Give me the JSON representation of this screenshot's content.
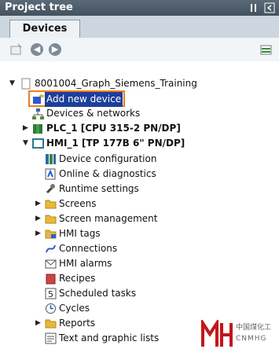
{
  "title": "Project tree",
  "tab_label": "Devices",
  "project": "8001004_Graph_Siemens_Training",
  "tree": [
    {
      "label": "Add new device",
      "icon": "add-device-icon"
    },
    {
      "label": "Devices & networks",
      "icon": "network-icon"
    },
    {
      "label": "PLC_1 [CPU 315-2 PN/DP]",
      "icon": "plc-icon"
    },
    {
      "label": "HMI_1 [TP 177B 6\" PN/DP]",
      "icon": "hmi-icon"
    },
    {
      "label": "Device configuration",
      "icon": "device-config-icon"
    },
    {
      "label": "Online & diagnostics",
      "icon": "diagnostics-icon"
    },
    {
      "label": "Runtime settings",
      "icon": "runtime-settings-icon"
    },
    {
      "label": "Screens",
      "icon": "folder-icon"
    },
    {
      "label": "Screen management",
      "icon": "folder-icon"
    },
    {
      "label": "HMI tags",
      "icon": "hmi-tags-icon"
    },
    {
      "label": "Connections",
      "icon": "connections-icon"
    },
    {
      "label": "HMI alarms",
      "icon": "alarms-icon"
    },
    {
      "label": "Recipes",
      "icon": "recipes-icon"
    },
    {
      "label": "Scheduled tasks",
      "icon": "tasks-icon"
    },
    {
      "label": "Cycles",
      "icon": "cycles-icon"
    },
    {
      "label": "Reports",
      "icon": "folder-icon"
    },
    {
      "label": "Text and graphic lists",
      "icon": "text-lists-icon"
    }
  ],
  "watermark": {
    "cn": "中国煤化工",
    "en": "CNMHG"
  },
  "colors": {
    "titlebar": "#4e5d6a",
    "selection": "#1d3f9a",
    "highlight": "#f07d1a",
    "watermark": "#c4161c"
  }
}
